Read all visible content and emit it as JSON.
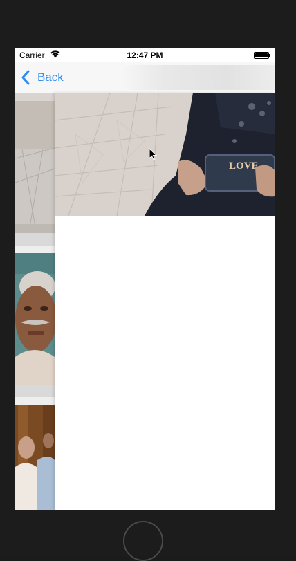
{
  "status_bar": {
    "carrier": "Carrier",
    "time": "12:47 PM"
  },
  "nav_bar": {
    "back_label": "Back"
  },
  "hero_image": {
    "bag_text": "LOVE"
  },
  "colors": {
    "accent": "#2f8cf0",
    "device_frame": "#1c1c1c"
  }
}
